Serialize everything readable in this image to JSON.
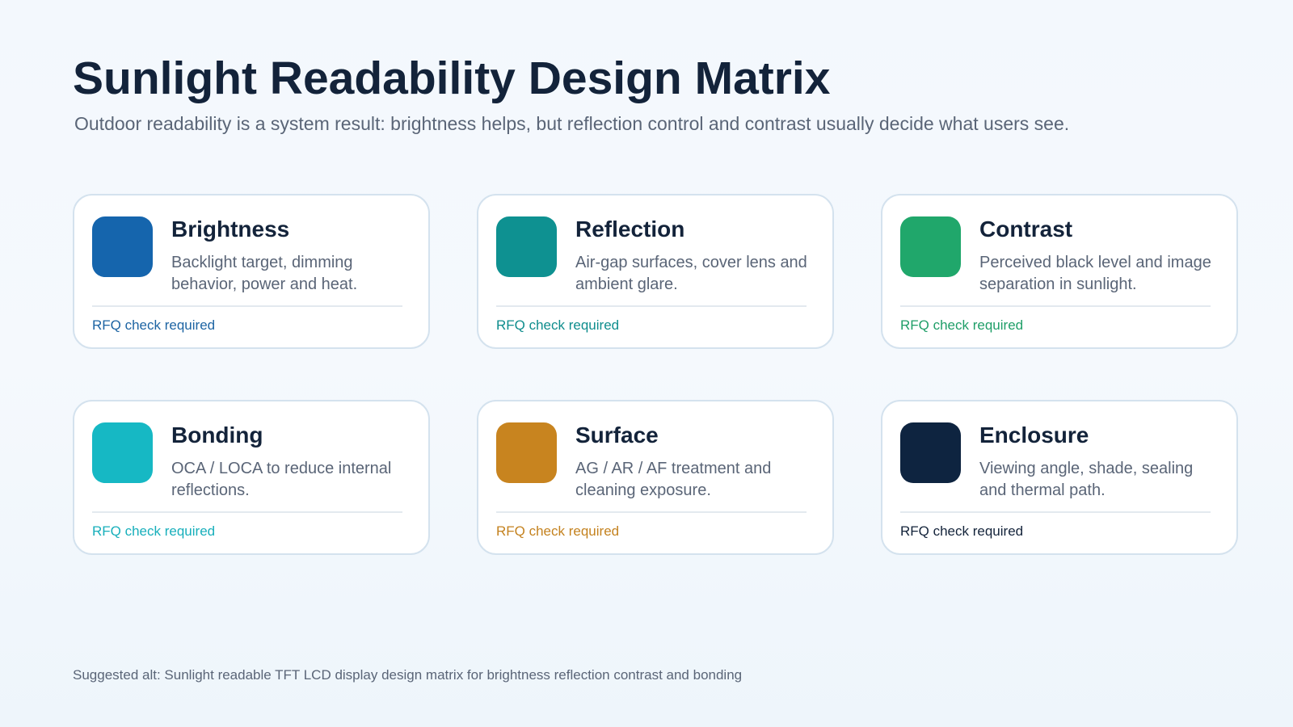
{
  "header": {
    "title": "Sunlight Readability Design Matrix",
    "subtitle": "Outdoor readability is a system result: brightness helps, but reflection control and contrast usually decide what users see."
  },
  "cards": [
    {
      "title": "Brightness",
      "description": "Backlight target, dimming behavior, power and heat.",
      "status": "RFQ check required",
      "color": "#1565ad",
      "status_color": "#1d64a3"
    },
    {
      "title": "Reflection",
      "description": "Air-gap surfaces, cover lens and ambient glare.",
      "status": "RFQ check required",
      "color": "#0e9191",
      "status_color": "#0e8d8d"
    },
    {
      "title": "Contrast",
      "description": "Perceived black level and image separation in sunlight.",
      "status": "RFQ check required",
      "color": "#20a76b",
      "status_color": "#1f9e68"
    },
    {
      "title": "Bonding",
      "description": "OCA / LOCA to reduce internal reflections.",
      "status": "RFQ check required",
      "color": "#16b8c4",
      "status_color": "#17afbb"
    },
    {
      "title": "Surface",
      "description": "AG / AR / AF treatment and cleaning exposure.",
      "status": "RFQ check required",
      "color": "#c8841f",
      "status_color": "#c4821f"
    },
    {
      "title": "Enclosure",
      "description": "Viewing angle, shade, sealing and thermal path.",
      "status": "RFQ check required",
      "color": "#0e2440",
      "status_color": "#13233a"
    }
  ],
  "footer": {
    "alt_text": "Suggested alt: Sunlight readable TFT LCD display design matrix for brightness reflection contrast and bonding"
  }
}
